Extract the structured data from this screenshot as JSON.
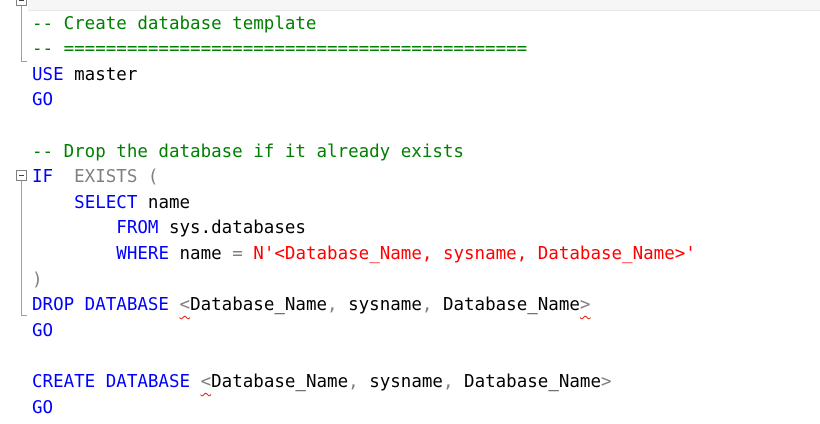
{
  "editor": {
    "lines": [
      {
        "segments": [
          {
            "text": "-- ============================================",
            "class": "cmt"
          }
        ]
      },
      {
        "segments": [
          {
            "text": "-- Create database template",
            "class": "cmt"
          }
        ]
      },
      {
        "segments": [
          {
            "text": "-- ============================================",
            "class": "cmt"
          }
        ]
      },
      {
        "segments": [
          {
            "text": "USE",
            "class": "kw"
          },
          {
            "text": " master",
            "class": "plain"
          }
        ]
      },
      {
        "segments": [
          {
            "text": "GO",
            "class": "kw"
          }
        ]
      },
      {
        "segments": []
      },
      {
        "segments": [
          {
            "text": "-- Drop the database if it already exists",
            "class": "cmt"
          }
        ]
      },
      {
        "segments": [
          {
            "text": "IF",
            "class": "kw"
          },
          {
            "text": "  EXISTS (",
            "class": "gray"
          }
        ]
      },
      {
        "segments": [
          {
            "text": "    ",
            "class": "plain"
          },
          {
            "text": "SELECT",
            "class": "kw"
          },
          {
            "text": " name",
            "class": "plain"
          }
        ]
      },
      {
        "segments": [
          {
            "text": "        ",
            "class": "plain"
          },
          {
            "text": "FROM",
            "class": "kw"
          },
          {
            "text": " sys.databases",
            "class": "plain"
          }
        ]
      },
      {
        "segments": [
          {
            "text": "        ",
            "class": "plain"
          },
          {
            "text": "WHERE",
            "class": "kw"
          },
          {
            "text": " name ",
            "class": "plain"
          },
          {
            "text": "=",
            "class": "gray"
          },
          {
            "text": " ",
            "class": "plain"
          },
          {
            "text": "N'<Database_Name, sysname, Database_Name>'",
            "class": "str"
          }
        ]
      },
      {
        "segments": [
          {
            "text": ")",
            "class": "gray"
          }
        ]
      },
      {
        "segments": [
          {
            "text": "DROP DATABASE",
            "class": "kw"
          },
          {
            "text": " ",
            "class": "plain"
          },
          {
            "text": "<",
            "class": "gray squig"
          },
          {
            "text": "Database_Name",
            "class": "plain"
          },
          {
            "text": ", ",
            "class": "gray"
          },
          {
            "text": "sysname",
            "class": "plain"
          },
          {
            "text": ", ",
            "class": "gray"
          },
          {
            "text": "Database_Name",
            "class": "plain"
          },
          {
            "text": ">",
            "class": "gray squig"
          }
        ]
      },
      {
        "segments": [
          {
            "text": "GO",
            "class": "kw"
          }
        ]
      },
      {
        "segments": []
      },
      {
        "segments": [
          {
            "text": "CREATE DATABASE",
            "class": "kw"
          },
          {
            "text": " ",
            "class": "plain"
          },
          {
            "text": "<",
            "class": "gray squig"
          },
          {
            "text": "Database_Name",
            "class": "plain"
          },
          {
            "text": ", ",
            "class": "gray"
          },
          {
            "text": "sysname",
            "class": "plain"
          },
          {
            "text": ", ",
            "class": "gray"
          },
          {
            "text": "Database_Name",
            "class": "plain"
          },
          {
            "text": ">",
            "class": "gray"
          }
        ]
      },
      {
        "segments": [
          {
            "text": "GO",
            "class": "kw"
          }
        ]
      }
    ]
  }
}
